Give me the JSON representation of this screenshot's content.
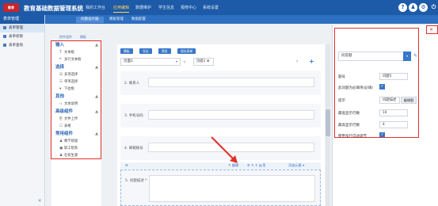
{
  "app": {
    "logo_text": "教育",
    "title": "教育基础数据管理系统"
  },
  "topnav": [
    {
      "label": "我的工作台",
      "active": false
    },
    {
      "label": "应用编辑",
      "active": true
    },
    {
      "label": "数据维护",
      "active": false
    },
    {
      "label": "学生信息",
      "active": false
    },
    {
      "label": "报修中心",
      "active": false
    },
    {
      "label": "系统设置",
      "active": false
    }
  ],
  "topicons": [
    "?",
    "♟",
    "⚙",
    "⏻"
  ],
  "subtabs": [
    {
      "label": "问题设计器",
      "active": true
    },
    {
      "label": "模板管理",
      "active": false
    },
    {
      "label": "数据配置",
      "active": false
    }
  ],
  "sidebar": {
    "title": "表单管理",
    "items": [
      {
        "label": "表单管理",
        "active": true
      },
      {
        "label": "表单权限",
        "active": false
      },
      {
        "label": "表单查询",
        "active": false
      }
    ],
    "collapse": "«"
  },
  "palette": {
    "tabs": [
      "控件组件",
      "模板"
    ],
    "sections": [
      {
        "title": "输入",
        "items": [
          {
            "icon": "T",
            "label": "文本框"
          },
          {
            "icon": "❝",
            "label": "多行文本框"
          }
        ]
      },
      {
        "title": "选择",
        "items": [
          {
            "icon": "☑",
            "label": "多项选择"
          },
          {
            "icon": "☷",
            "label": "单项选择"
          },
          {
            "icon": "▾",
            "label": "下拉框"
          }
        ]
      },
      {
        "title": "其他",
        "items": [
          {
            "icon": "‹›",
            "label": "文本说明"
          }
        ]
      },
      {
        "title": "高级组件",
        "items": [
          {
            "icon": "⎘",
            "label": "文件上传"
          },
          {
            "icon": "☐",
            "label": "表格"
          }
        ]
      },
      {
        "title": "常用组件",
        "items": [
          {
            "icon": "♟",
            "label": "教学班级"
          },
          {
            "icon": "▣",
            "label": "职工院系"
          },
          {
            "icon": "♟",
            "label": "在校生源"
          }
        ]
      }
    ]
  },
  "toolbar": [
    "模板",
    "导出",
    "预览",
    "保存表单"
  ],
  "pages": {
    "select": "页面1",
    "tab": "页面1 ⊗",
    "prev": "‹",
    "next": "›",
    "add": "+"
  },
  "questions": [
    {
      "label": "2. 联系人"
    },
    {
      "label": "3. 手机号码"
    },
    {
      "label": "4. 邮箱账号"
    }
  ],
  "qtoolbar": {
    "handle": "☰",
    "edit": "✎ 编辑",
    "icons": "⚙ ✎ ↕ ▤ ⎘",
    "add": "添加元素 ▾"
  },
  "question_last": {
    "label": "5. 问题描述 *"
  },
  "props": {
    "type_value": "问答题",
    "type_btn": "▾",
    "title_label": "题号",
    "title_value": "问题5",
    "required_label": "此问题为必填项(必填)",
    "tip_label": "提示",
    "tip_value": "问题描述",
    "tip_btn": "编辑题",
    "min_label": "最低显示行数",
    "min_value": "10",
    "max_label": "最高显示行数",
    "max_value": "4",
    "auto_label": "使用多行自动调节"
  },
  "accent": "#1d5aa7",
  "highlight": "#e0302a"
}
